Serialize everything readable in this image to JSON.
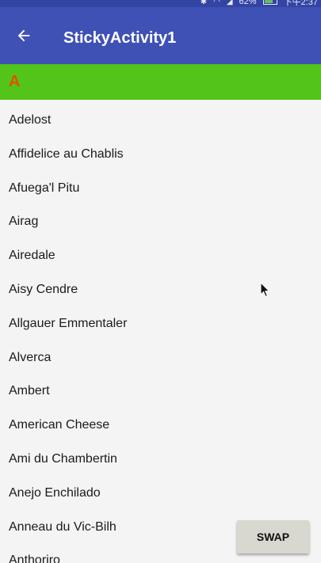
{
  "status_bar": {
    "battery": "62%",
    "time": "下午2:37"
  },
  "app_bar": {
    "title": "StickyActivity1"
  },
  "sticky_header": {
    "letter": "A"
  },
  "list_items": [
    "Adelost",
    "Affidelice au Chablis",
    "Afuega'l Pitu",
    "Airag",
    "Airedale",
    "Aisy Cendre",
    "Allgauer Emmentaler",
    "Alverca",
    "Ambert",
    "American Cheese",
    "Ami du Chambertin",
    "Anejo Enchilado",
    "Anneau du Vic-Bilh",
    "Anthoriro"
  ],
  "swap_button": {
    "label": "SWAP"
  },
  "colors": {
    "app_bar": "#3f51b5",
    "status_bar": "#3344a3",
    "sticky_header": "#52c41a",
    "sticky_letter": "#e65100"
  }
}
